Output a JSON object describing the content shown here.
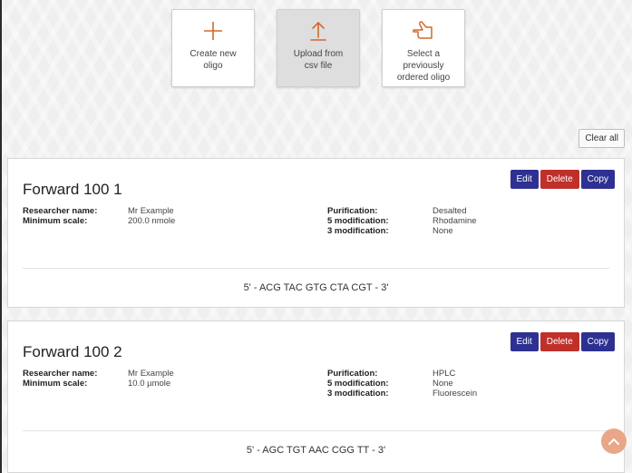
{
  "actions": [
    {
      "label_line1": "Create new",
      "label_line2": "oligo",
      "label_line3": "",
      "icon": "plus-icon"
    },
    {
      "label_line1": "Upload from",
      "label_line2": "csv file",
      "label_line3": "",
      "icon": "upload-icon"
    },
    {
      "label_line1": "Select a",
      "label_line2": "previously",
      "label_line3": "ordered oligo",
      "icon": "pointing-hand-icon"
    }
  ],
  "clear_all_label": "Clear all",
  "buttons": {
    "edit": "Edit",
    "delete": "Delete",
    "copy": "Copy"
  },
  "field_labels": {
    "researcher": "Researcher name:",
    "scale": "Minimum scale:",
    "purification": "Purification:",
    "mod5": "5 modification:",
    "mod3": "3 modification:"
  },
  "oligos": [
    {
      "title": "Forward 100 1",
      "researcher": "Mr Example",
      "scale": "200.0 nmole",
      "purification": "Desalted",
      "mod5": "Rhodamine",
      "mod3": "None",
      "sequence": "5' - ACG TAC GTG CTA CGT - 3'"
    },
    {
      "title": "Forward 100 2",
      "researcher": "Mr Example",
      "scale": "10.0 µmole",
      "purification": "HPLC",
      "mod5": "None",
      "mod3": "Fluorescein",
      "sequence": "5' - AGC TGT AAC CGG TT - 3'"
    }
  ],
  "colors": {
    "accent_orange": "#d2692a",
    "button_navy": "#2e3191",
    "button_red": "#c0302b"
  }
}
